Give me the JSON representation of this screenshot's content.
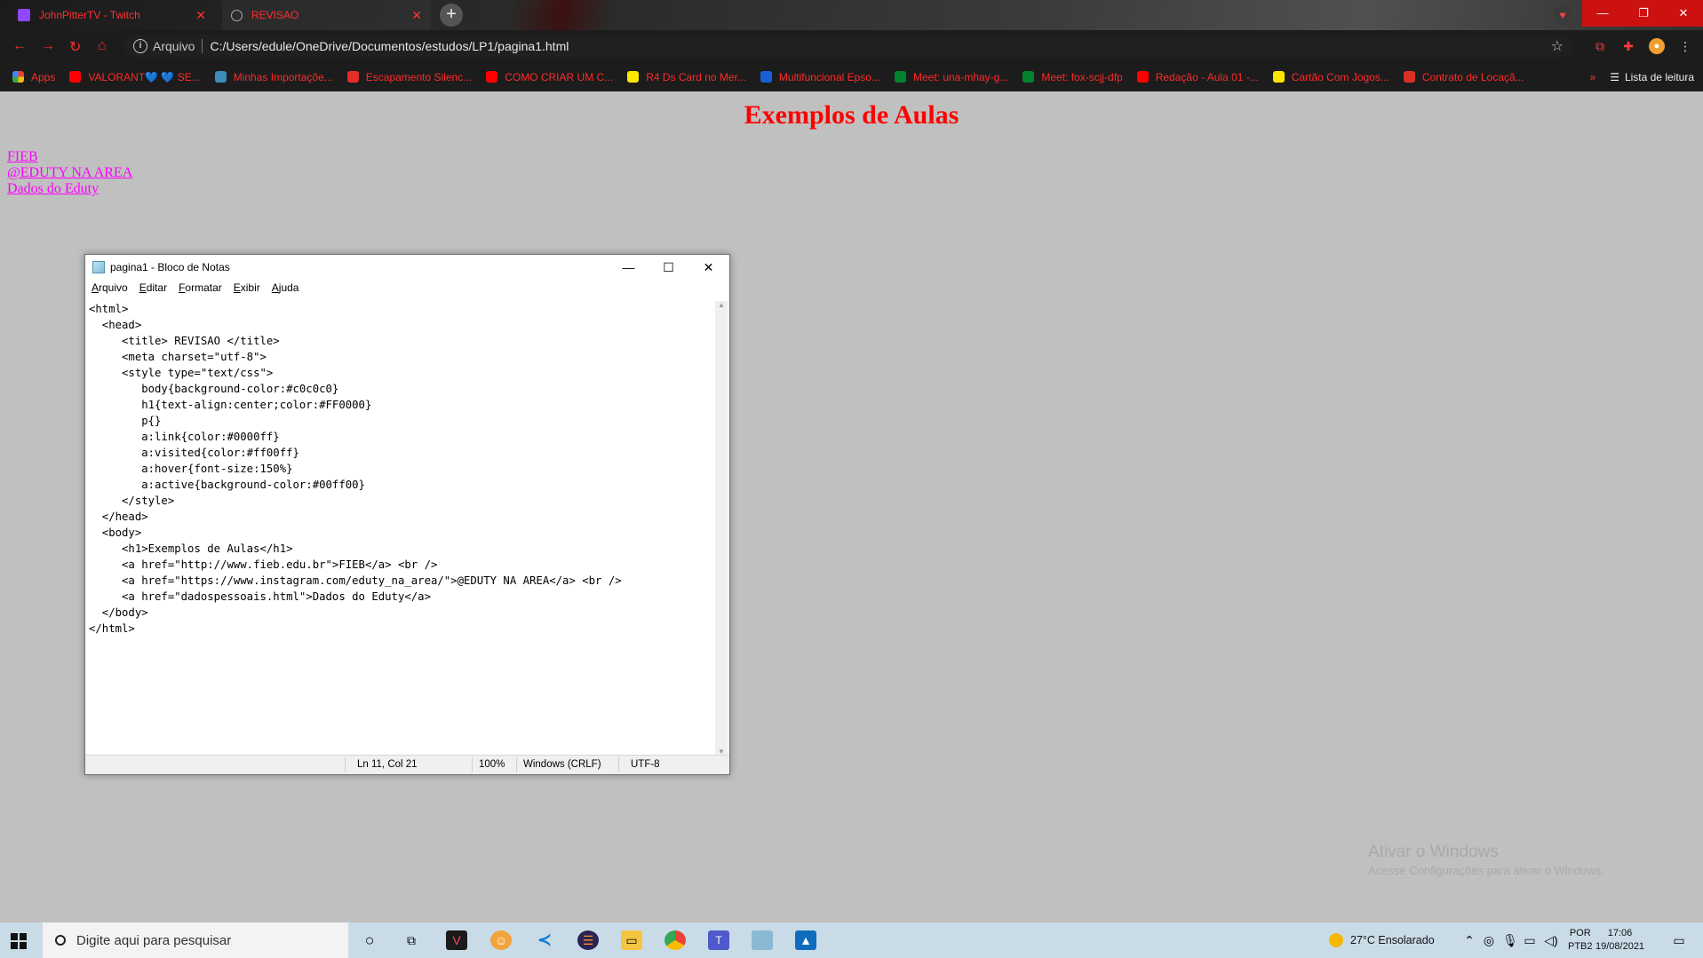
{
  "browser": {
    "tabs": [
      {
        "title": "JohnPitterTV - Twitch",
        "favicon": "twitch-icon"
      },
      {
        "title": "REVISAO",
        "favicon": "globe-icon"
      }
    ],
    "address_scheme": "Arquivo",
    "address_url": "C:/Users/edule/OneDrive/Documentos/estudos/LP1/pagina1.html",
    "bookmarks": [
      {
        "label": "Apps",
        "color": "#4285f4"
      },
      {
        "label": "VALORANT💙 💙 SE...",
        "color": "#ff0000"
      },
      {
        "label": "Minhas Importaçõe...",
        "color": "#3c8dbc"
      },
      {
        "label": "Escapamento Silenc...",
        "color": "#e52d27"
      },
      {
        "label": "COMO CRIAR UM C...",
        "color": "#ff0000"
      },
      {
        "label": "R4 Ds Card no Mer...",
        "color": "#ffe600"
      },
      {
        "label": "Multifuncional Epso...",
        "color": "#1a5fd8"
      },
      {
        "label": "Meet: una-mhay-g...",
        "color": "#00832d"
      },
      {
        "label": "Meet: fox-scjj-dfp",
        "color": "#00832d"
      },
      {
        "label": "Redação - Aula 01 -...",
        "color": "#ff0000"
      },
      {
        "label": "Cartão Com Jogos...",
        "color": "#ffe600"
      },
      {
        "label": "Contrato de Locaçã...",
        "color": "#d93025"
      }
    ],
    "bookmarks_overflow": "»",
    "reading_list": "Lista de leitura",
    "accent": "#ff2a2a"
  },
  "page": {
    "heading": "Exemplos de Aulas",
    "links": [
      "FIEB",
      "@EDUTY NA AREA",
      "Dados do Eduty"
    ],
    "heading_color": "#FF0000",
    "link_color": "#ff00ff",
    "background": "#c0c0c0"
  },
  "notepad": {
    "title": "pagina1 - Bloco de Notas",
    "menu": [
      "Arquivo",
      "Editar",
      "Formatar",
      "Exibir",
      "Ajuda"
    ],
    "content": "<html>\n  <head>\n     <title> REVISAO </title>\n     <meta charset=\"utf-8\">\n     <style type=\"text/css\">\n        body{background-color:#c0c0c0}\n        h1{text-align:center;color:#FF0000}\n        p{}\n        a:link{color:#0000ff}\n        a:visited{color:#ff00ff}\n        a:hover{font-size:150%}\n        a:active{background-color:#00ff00}\n     </style>\n  </head>\n  <body>\n     <h1>Exemplos de Aulas</h1>\n     <a href=\"http://www.fieb.edu.br\">FIEB</a> <br />\n     <a href=\"https://www.instagram.com/eduty_na_area/\">@EDUTY NA AREA</a> <br />\n     <a href=\"dadospessoais.html\">Dados do Eduty</a>\n  </body>\n</html>",
    "status": {
      "position": "Ln 11, Col 21",
      "zoom": "100%",
      "line_ending": "Windows (CRLF)",
      "encoding": "UTF-8"
    }
  },
  "watermark": {
    "line1": "Ativar o Windows",
    "line2": "Acesse Configurações para ativar o Windows."
  },
  "taskbar": {
    "search_placeholder": "Digite aqui para pesquisar",
    "weather": "27°C  Ensolarado",
    "lang1": "POR",
    "lang2": "PTB2",
    "time": "17:06",
    "date": "19/08/2021"
  }
}
